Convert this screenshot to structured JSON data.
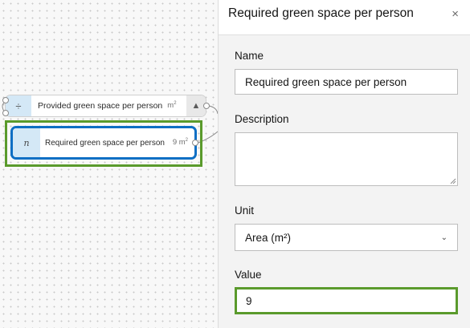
{
  "canvas": {
    "divide_node": {
      "operator": "÷",
      "name": "Provided green space per person",
      "unit_base": "m",
      "unit_exp": "2"
    },
    "constant_node": {
      "operator": "n",
      "name": "Required green space per person",
      "unit_base": "9 m",
      "unit_exp": "2"
    }
  },
  "panel": {
    "title": "Required green space per person",
    "close_label": "×",
    "name_label": "Name",
    "name_value": "Required green space per person",
    "description_label": "Description",
    "description_value": "",
    "unit_label": "Unit",
    "unit_value": "Area (m²)",
    "value_label": "Value",
    "value_value": "9"
  },
  "colors": {
    "selection_blue": "#0e6fc4",
    "highlight_green": "#5a9a2c",
    "operator_fill": "#d4e8f6"
  }
}
